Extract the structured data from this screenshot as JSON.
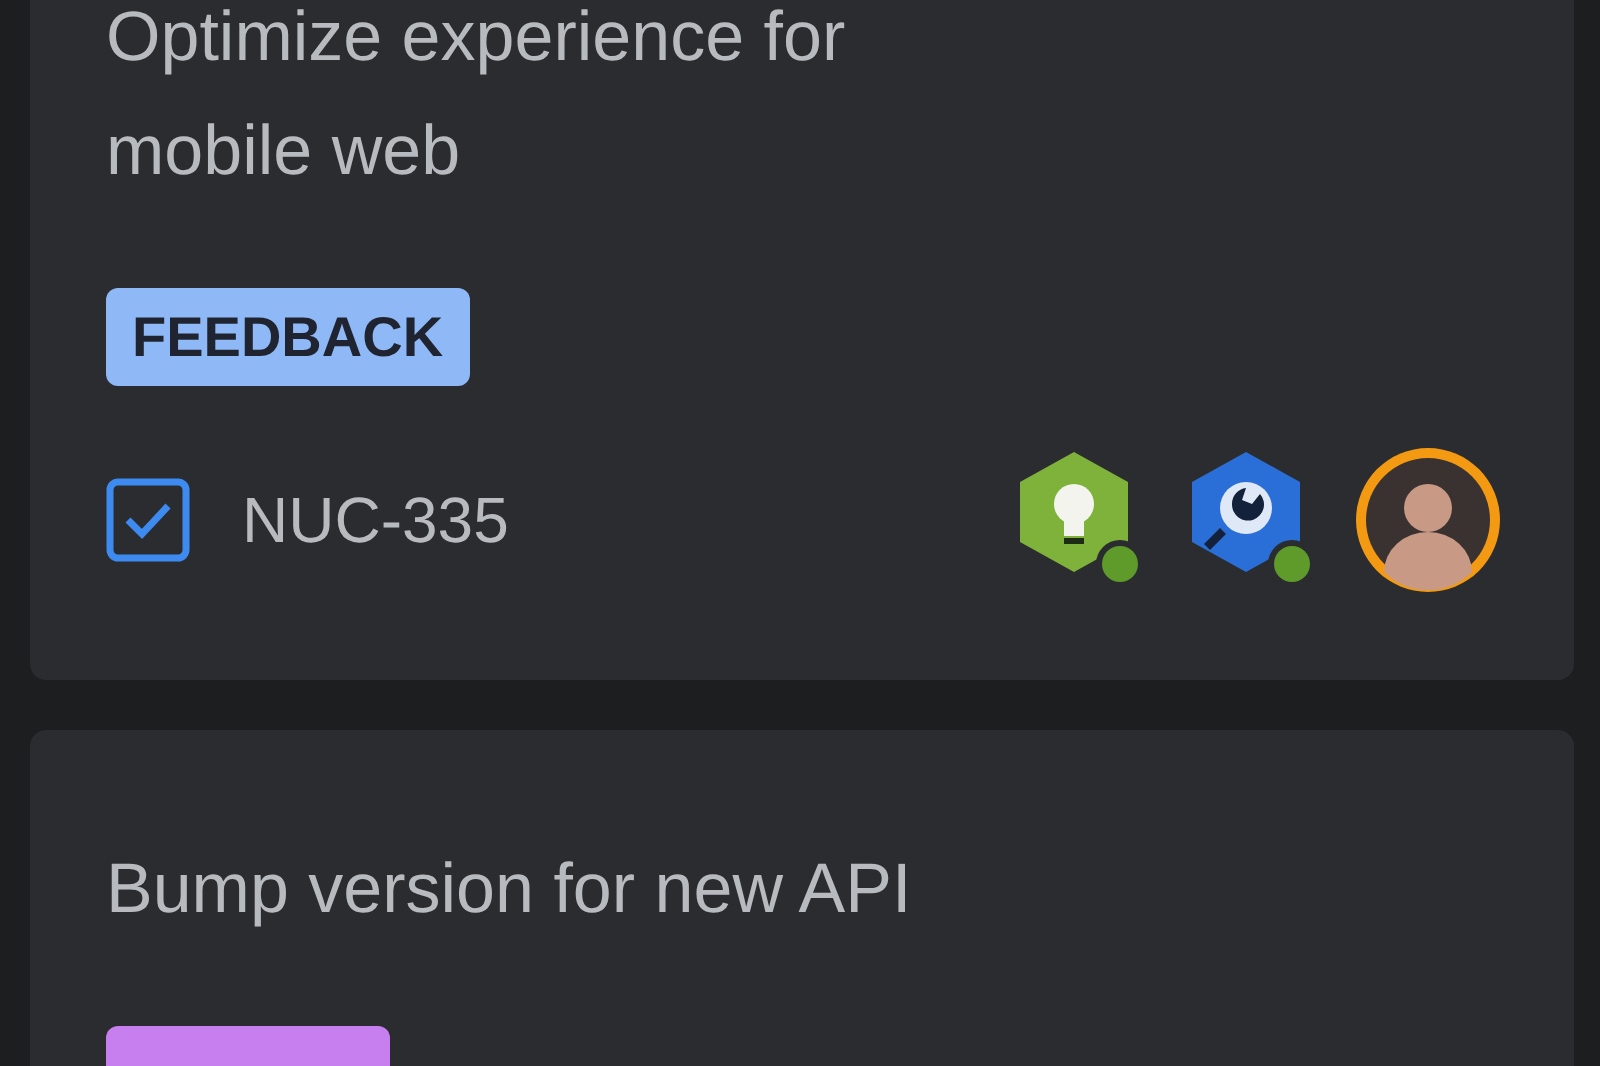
{
  "cards": [
    {
      "title": "Optimize experience for mobile web",
      "tag": {
        "label": "FEEDBACK",
        "color": "#8fb8f6"
      },
      "footer": {
        "key": "NUC-335"
      }
    },
    {
      "title": "Bump version for new API",
      "tag": {
        "color": "#c77ff0"
      }
    }
  ]
}
